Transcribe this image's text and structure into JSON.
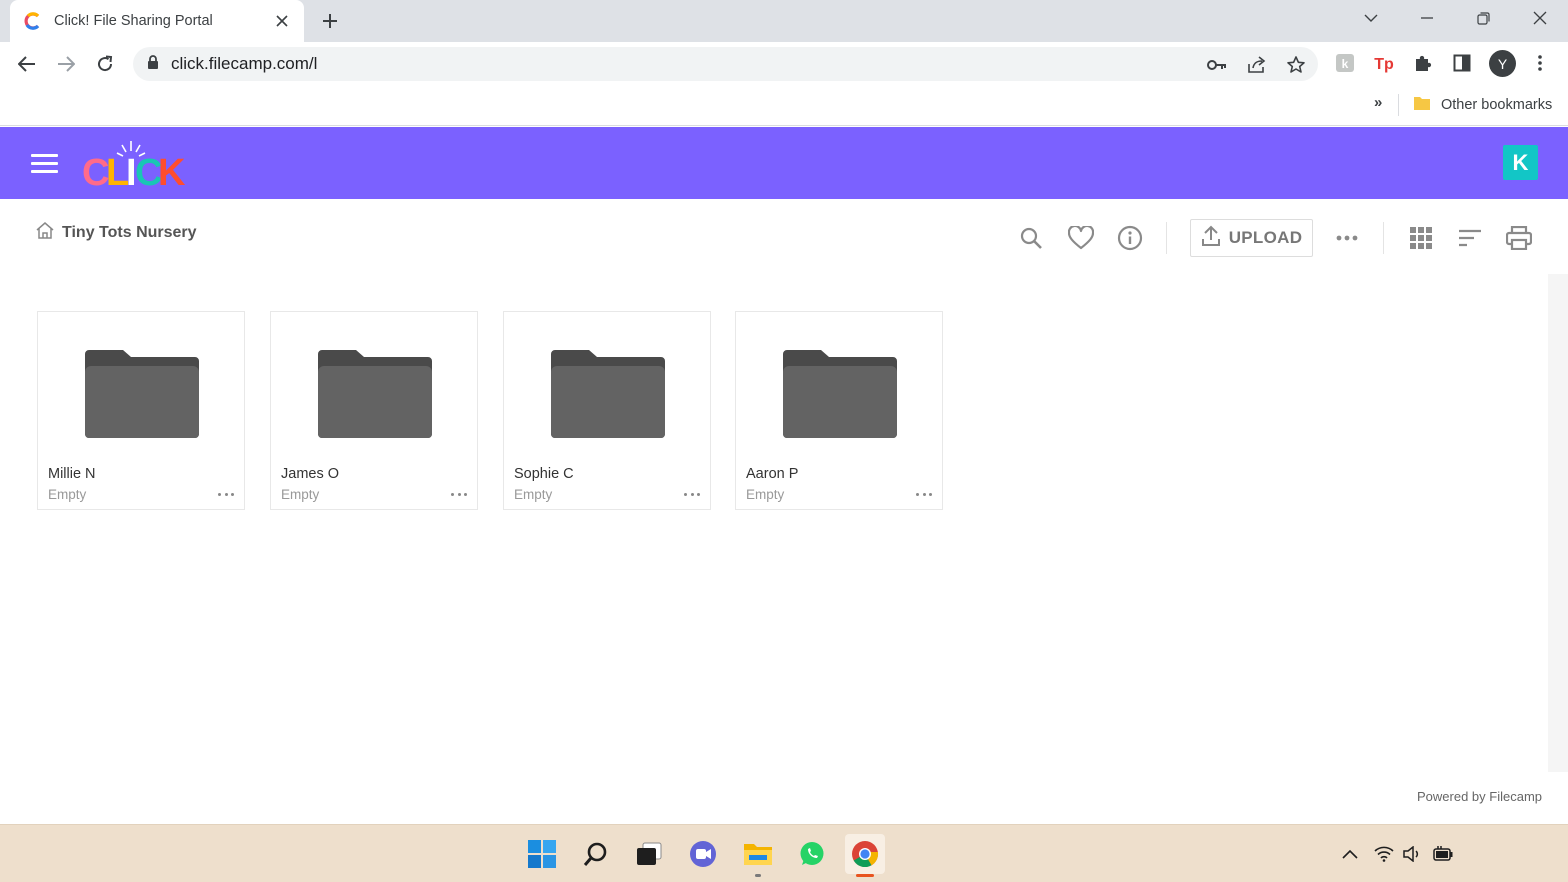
{
  "browser": {
    "tab_title": "Click! File Sharing Portal",
    "url": "click.filecamp.com/l",
    "profile_initial": "Y",
    "bookmarks_overflow": "»",
    "other_bookmarks": "Other bookmarks"
  },
  "header": {
    "logo_text": "CLICK",
    "avatar_initial": "K",
    "background_color": "#7b61ff",
    "avatar_color": "#12c6c6"
  },
  "breadcrumb": {
    "home_icon": "home-icon",
    "label": "Tiny Tots Nursery"
  },
  "actions": {
    "upload_label": "UPLOAD",
    "icons": [
      "search-icon",
      "heart-icon",
      "info-icon",
      "upload-icon",
      "more-icon",
      "grid-view-icon",
      "sort-icon",
      "print-icon"
    ]
  },
  "folders": [
    {
      "name": "Millie N",
      "status": "Empty"
    },
    {
      "name": "James O",
      "status": "Empty"
    },
    {
      "name": "Sophie C",
      "status": "Empty"
    },
    {
      "name": "Aaron P",
      "status": "Empty"
    }
  ],
  "footer": {
    "powered_by": "Powered by Filecamp"
  },
  "taskbar": {
    "apps": [
      "windows-start-icon",
      "search-icon",
      "task-view-icon",
      "video-call-icon",
      "file-explorer-icon",
      "whatsapp-icon",
      "chrome-icon"
    ],
    "tray": [
      "chevron-up-icon",
      "wifi-icon",
      "volume-icon",
      "battery-icon"
    ]
  }
}
